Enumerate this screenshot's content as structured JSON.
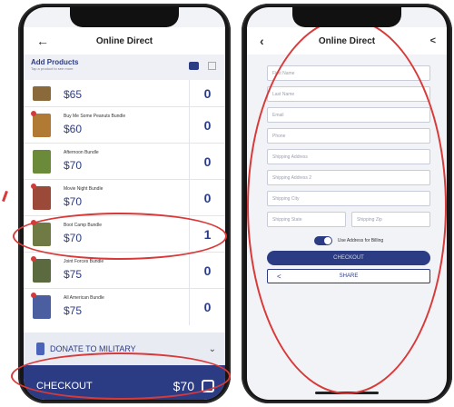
{
  "left": {
    "title": "Online Direct",
    "add_products": {
      "title": "Add Products",
      "subtitle": "Tap a product to see more"
    },
    "products": [
      {
        "name": "",
        "price": "$65",
        "qty": "0",
        "color": "#8a6a3a"
      },
      {
        "name": "Buy Me Some Peanuts Bundle",
        "price": "$60",
        "qty": "0",
        "color": "#b07a35"
      },
      {
        "name": "Afternoon Bundle",
        "price": "$70",
        "qty": "0",
        "color": "#6b8a3a"
      },
      {
        "name": "Movie Night Bundle",
        "price": "$70",
        "qty": "0",
        "color": "#9b4a3a"
      },
      {
        "name": "Boot Camp Bundle",
        "price": "$70",
        "qty": "1",
        "color": "#6f7a45"
      },
      {
        "name": "Joint Forces Bundle",
        "price": "$75",
        "qty": "0",
        "color": "#5c6a40"
      },
      {
        "name": "All American Bundle",
        "price": "$75",
        "qty": "0",
        "color": "#4b5ea0"
      }
    ],
    "donate_label": "DONATE TO MILITARY",
    "checkout_label": "CHECKOUT",
    "total": "$70"
  },
  "right": {
    "title": "Online Direct",
    "fields": {
      "first_name": "First Name",
      "last_name": "Last Name",
      "email": "Email",
      "phone": "Phone",
      "shipping_address1": "Shipping Address",
      "shipping_address2": "Shipping Address 2",
      "shipping_city": "Shipping City",
      "shipping_state": "Shipping State",
      "shipping_zip": "Shipping Zip"
    },
    "toggle_label": "Use Address for Billing",
    "checkout_label": "CHECKOUT",
    "share_label": "SHARE"
  },
  "colors": {
    "brand": "#2c3c84",
    "annotation": "#d83a3a"
  }
}
